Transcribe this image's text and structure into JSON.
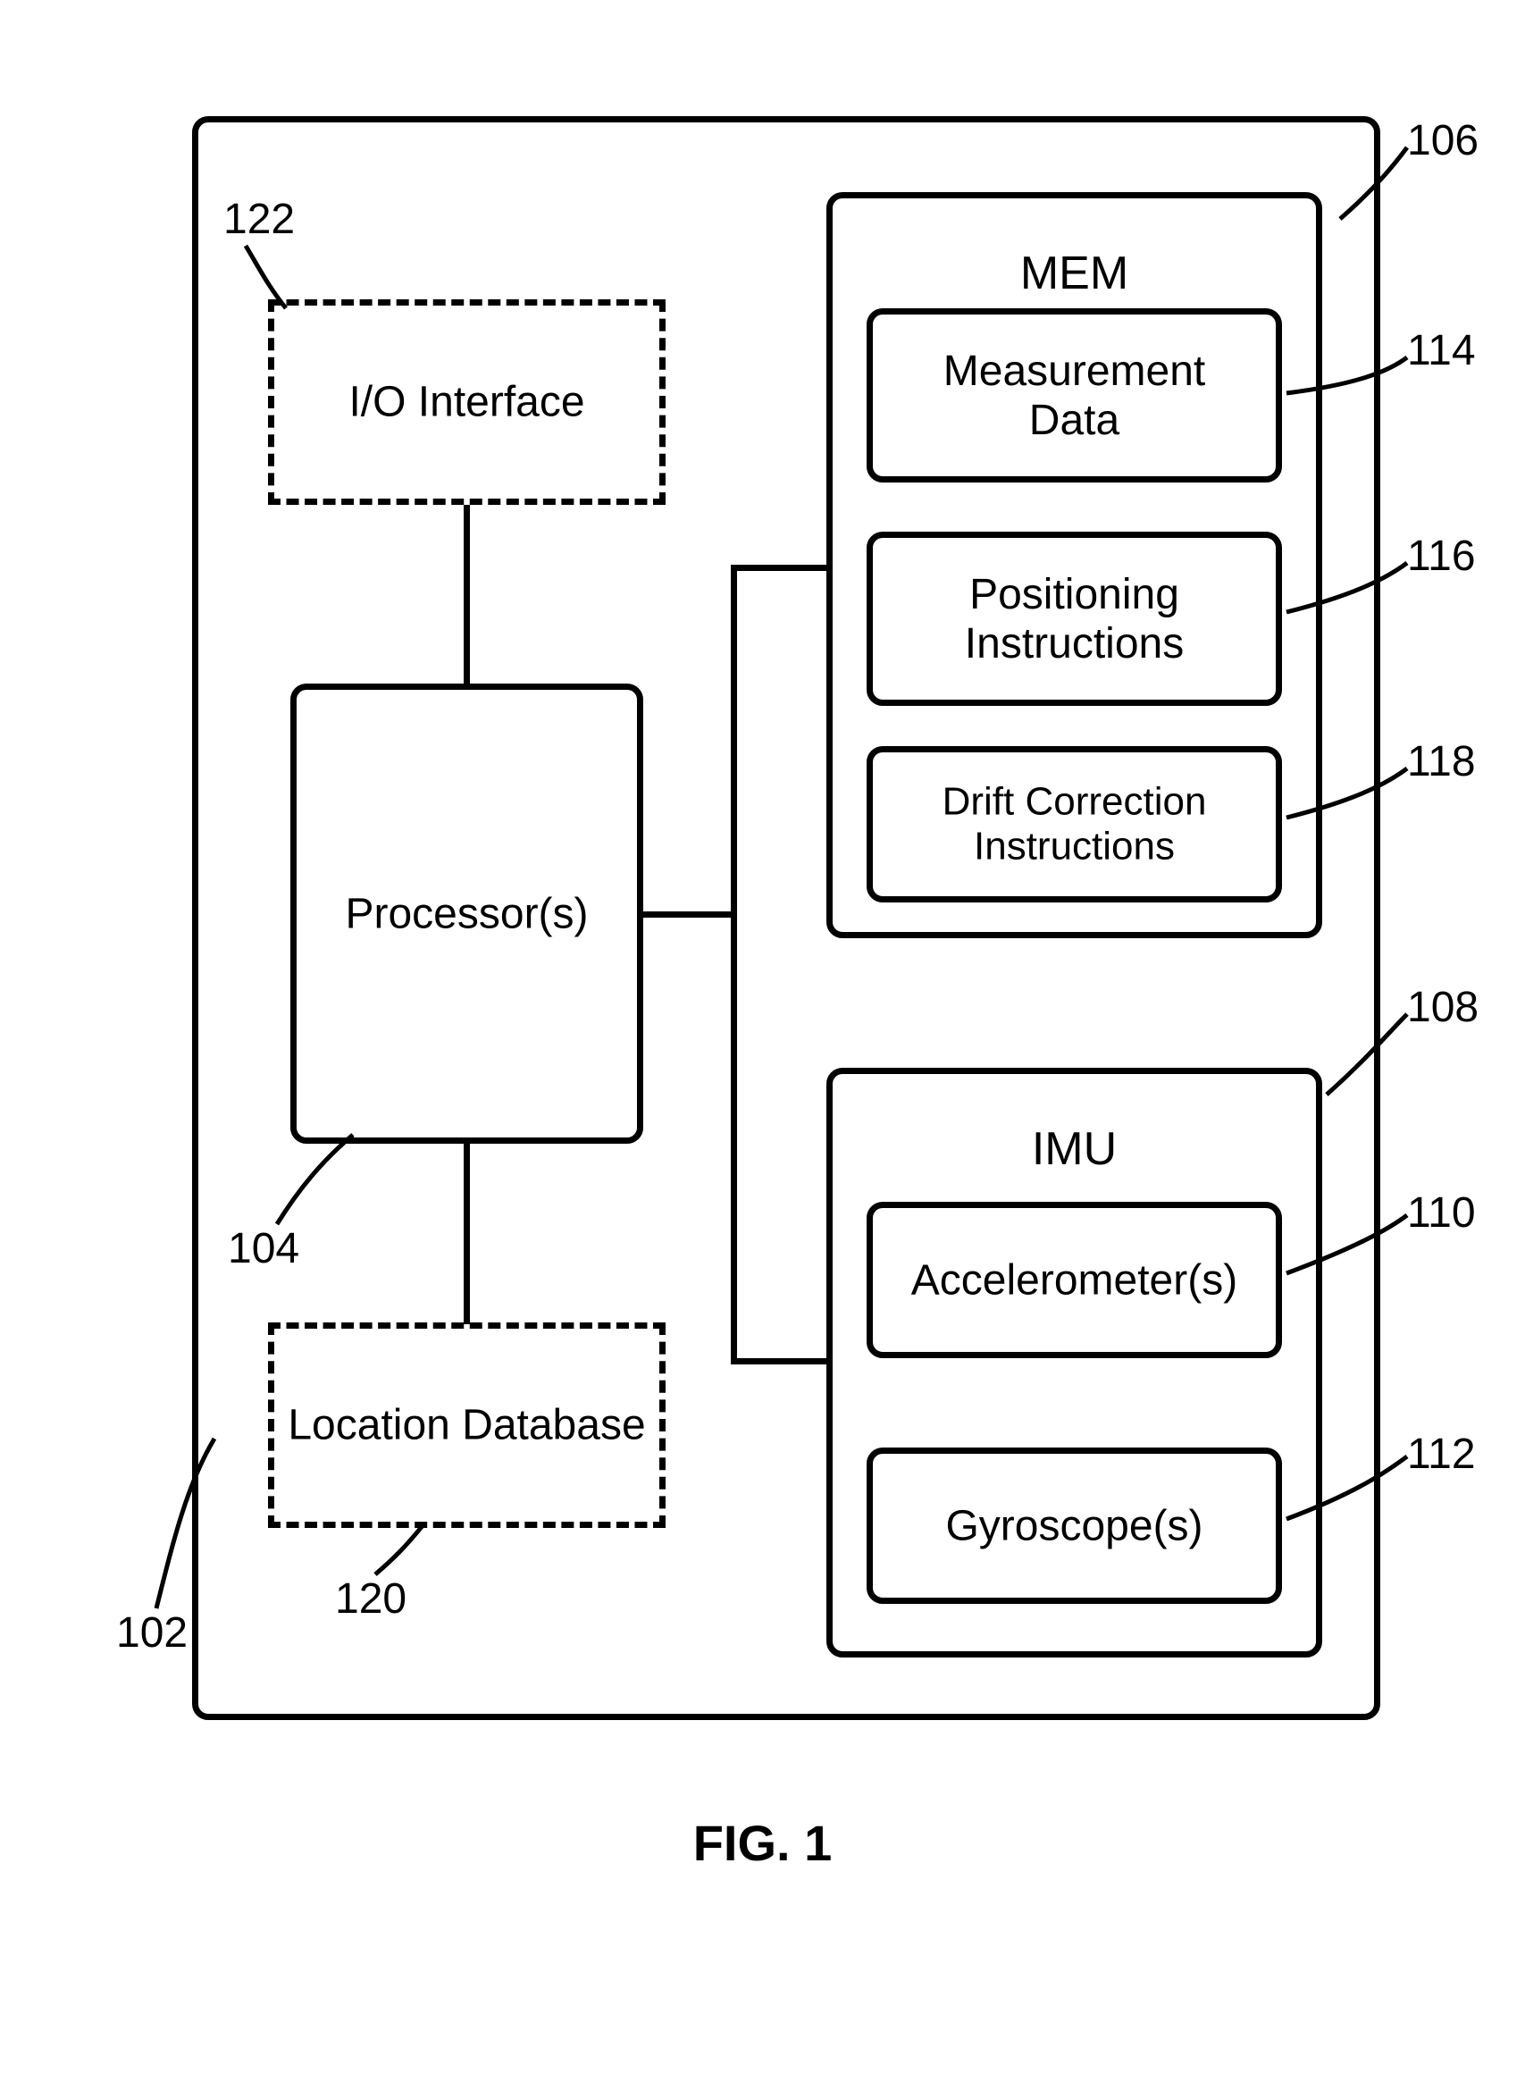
{
  "refs": {
    "r102": "102",
    "r104": "104",
    "r106": "106",
    "r108": "108",
    "r110": "110",
    "r112": "112",
    "r114": "114",
    "r116": "116",
    "r118": "118",
    "r120": "120",
    "r122": "122"
  },
  "blocks": {
    "processor": "Processor(s)",
    "io": "I/O Interface",
    "locdb": "Location Database",
    "mem_title": "MEM",
    "meas": "Measurement\nData",
    "posinstr": "Positioning\nInstructions",
    "drift": "Drift Correction\nInstructions",
    "imu_title": "IMU",
    "accel": "Accelerometer(s)",
    "gyro": "Gyroscope(s)"
  },
  "figure": "FIG. 1"
}
